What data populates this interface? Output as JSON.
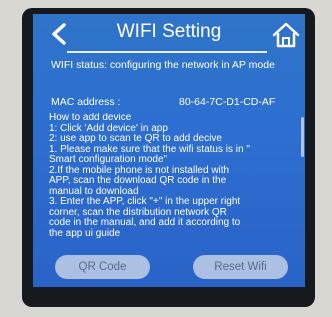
{
  "header": {
    "title": "WIFI Setting"
  },
  "status": {
    "text": "WIFI status: configuring the network in AP mode"
  },
  "mac": {
    "label": "MAC address :",
    "value": "80-64-7C-D1-CD-AF"
  },
  "help": {
    "lines": [
      "How to add device",
      "1: Click 'Add device' in app",
      "2: use app to scan te QR to add decive",
      "1. Please make sure that the wifi status is in \"",
      "Smart configuration mode\"",
      "2.If the mobile phone is not installed with",
      "APP, scan the download QR code in the",
      "manual to download",
      "3. Enter the APP, click \"+\" in the upper right",
      "corner, scan the distribution network QR",
      "code in the manual, and add it according to",
      "the app ui guide"
    ]
  },
  "buttons": {
    "qr_label": "QR Code",
    "reset_label": "Reset Wifi"
  },
  "colors": {
    "screen_bg": "#2d6fd0",
    "button_bg": "#c8d4e8",
    "button_text": "#5b6a86"
  }
}
